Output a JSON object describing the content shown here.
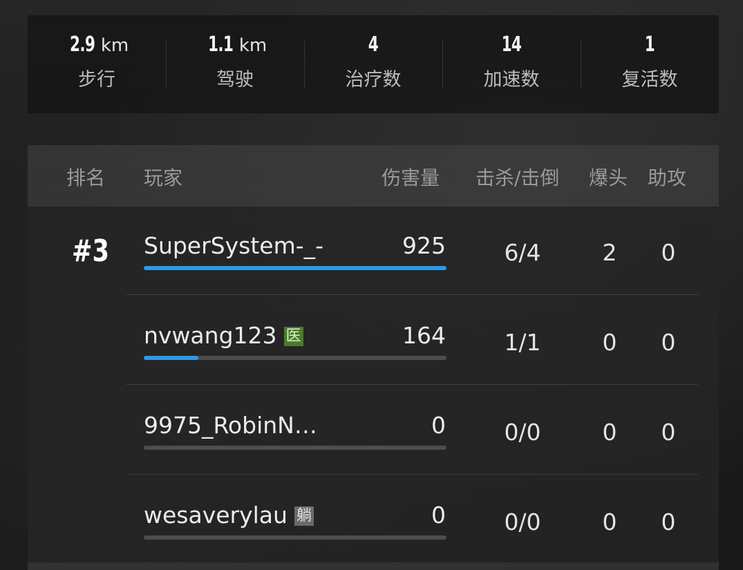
{
  "stats": [
    {
      "value": "2.9",
      "unit": "km",
      "label": "步行"
    },
    {
      "value": "1.1",
      "unit": "km",
      "label": "驾驶"
    },
    {
      "value": "4",
      "unit": "",
      "label": "治疗数"
    },
    {
      "value": "14",
      "unit": "",
      "label": "加速数"
    },
    {
      "value": "1",
      "unit": "",
      "label": "复活数"
    }
  ],
  "headers": {
    "rank": "排名",
    "player": "玩家",
    "damage": "伤害量",
    "kills": "击杀/击倒",
    "headshots": "爆头",
    "assists": "助攻"
  },
  "team_rank": "#3",
  "players": [
    {
      "name": "SuperSystem-_-",
      "tag": "",
      "damage": "925",
      "damage_fraction": 1.0,
      "kills": "6/4",
      "headshots": "2",
      "assists": "0"
    },
    {
      "name": "nvwang123",
      "tag": "医",
      "damage": "164",
      "damage_fraction": 0.18,
      "kills": "1/1",
      "headshots": "0",
      "assists": "0"
    },
    {
      "name": "9975_RobinN…",
      "tag": "",
      "damage": "0",
      "damage_fraction": 0,
      "kills": "0/0",
      "headshots": "0",
      "assists": "0"
    },
    {
      "name": "wesaverylau",
      "tag": "躺",
      "damage": "0",
      "damage_fraction": 0,
      "kills": "0/0",
      "headshots": "0",
      "assists": "0"
    }
  ],
  "colors": {
    "damage_bar": "#2d9ae8",
    "medic_tag": "#4b7a2c",
    "down_tag": "#6b6b6b"
  }
}
